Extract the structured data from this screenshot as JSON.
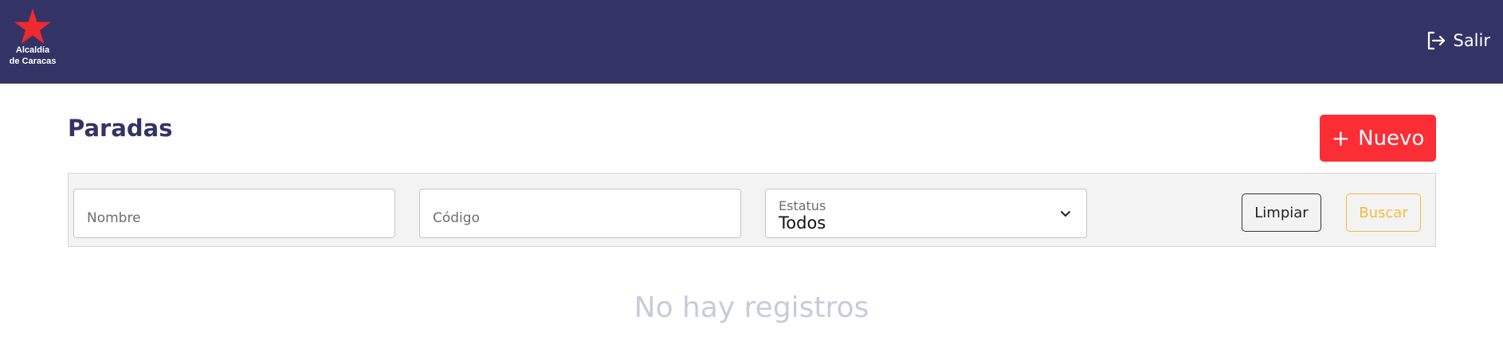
{
  "header": {
    "logo_line1": "Alcaldía",
    "logo_line2": "de Caracas",
    "logout_label": "Salir",
    "logout_icon": "logout-icon",
    "brand_color": "#343366",
    "star_color": "#ee2a2e"
  },
  "page": {
    "title": "Paradas",
    "new_button_plus": "+",
    "new_button_label": "Nuevo",
    "new_button_color": "#fc2e35"
  },
  "filters": {
    "name": {
      "placeholder": "Nombre",
      "value": ""
    },
    "code": {
      "placeholder": "Código",
      "value": ""
    },
    "status": {
      "label": "Estatus",
      "value": "Todos",
      "icon": "chevron-down-icon"
    },
    "clear_label": "Limpiar",
    "search_label": "Buscar",
    "search_color": "#f2bc3c"
  },
  "results": {
    "empty_message": "No hay registros"
  }
}
